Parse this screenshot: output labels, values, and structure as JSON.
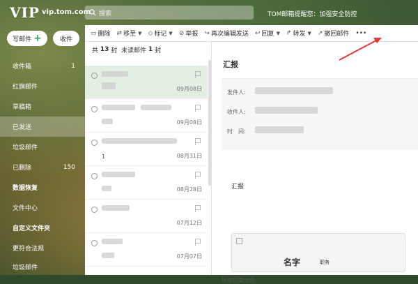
{
  "header": {
    "logo": "VIP",
    "domain": "vip.tom.com",
    "search_placeholder": "搜索",
    "notice": "TOM邮箱提醒您：加强安全防控"
  },
  "sidebar": {
    "compose": "写邮件",
    "receive": "收件",
    "items": [
      {
        "label": "收件箱",
        "count": "1"
      },
      {
        "label": "红旗邮件",
        "count": ""
      },
      {
        "label": "草稿箱",
        "count": ""
      },
      {
        "label": "已发送",
        "count": ""
      },
      {
        "label": "垃圾邮件",
        "count": ""
      },
      {
        "label": "已删除",
        "count": "150"
      },
      {
        "label": "数据恢复",
        "count": ""
      },
      {
        "label": "文件中心",
        "count": ""
      },
      {
        "label": "自定义文件夹",
        "count": ""
      },
      {
        "label": "更符合法规",
        "count": ""
      },
      {
        "label": "垃圾邮件",
        "count": ""
      }
    ]
  },
  "toolbar": {
    "delete": "删除",
    "move": "移至",
    "mark": "标记",
    "report": "举报",
    "reedit": "再次编辑发送",
    "reply": "回复",
    "forward": "转发",
    "recall": "撤回邮件",
    "more": "•••"
  },
  "list": {
    "total_prefix": "共",
    "total": "13",
    "total_suffix": "封",
    "unread_prefix": "未读邮件",
    "unread": "1",
    "unread_suffix": "封",
    "rows": [
      {
        "text": "",
        "date": "09月08日"
      },
      {
        "text": "",
        "date": "09月08日"
      },
      {
        "text": "1",
        "date": "08月31日"
      },
      {
        "text": "",
        "date": "08月28日"
      },
      {
        "text": "",
        "date": "07月12日"
      },
      {
        "text": "",
        "date": "07月07日"
      }
    ]
  },
  "detail": {
    "subject": "汇报",
    "from_label": "发件人:",
    "to_label": "收件人:",
    "time_label": "时　间:",
    "body": "汇报",
    "card_name": "名字",
    "card_role": "职务",
    "quick_reply": "快速回复全部"
  },
  "colors": {
    "accent": "#3aa04a",
    "selected_row": "#e3efe3",
    "arrow": "#e53935"
  }
}
